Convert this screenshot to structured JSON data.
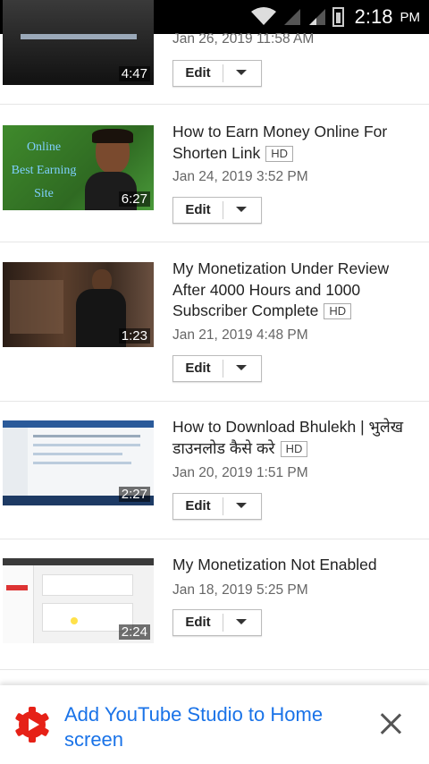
{
  "status_bar": {
    "time": "2:18",
    "ampm": "PM"
  },
  "videos": [
    {
      "duration": "4:47",
      "date": "Jan 26, 2019 11:58 AM",
      "edit_label": "Edit"
    },
    {
      "title": "How to Earn Money Online For Shorten Link",
      "hd": "HD",
      "duration": "6:27",
      "date": "Jan 24, 2019 3:52 PM",
      "edit_label": "Edit",
      "thumb_text": "Online\nBest Earning\nSite"
    },
    {
      "title": "My Monetization Under Review After 4000 Hours and 1000 Subscriber Complete",
      "hd": "HD",
      "duration": "1:23",
      "date": "Jan 21, 2019 4:48 PM",
      "edit_label": "Edit"
    },
    {
      "title": "How to Download Bhulekh | भुलेख डाउनलोड कैसे करे",
      "hd": "HD",
      "duration": "2:27",
      "date": "Jan 20, 2019 1:51 PM",
      "edit_label": "Edit"
    },
    {
      "title": "My Monetization Not Enabled",
      "duration": "2:24",
      "date": "Jan 18, 2019 5:25 PM",
      "edit_label": "Edit"
    }
  ],
  "banner": {
    "text": "Add YouTube Studio to Home screen"
  },
  "colors": {
    "banner_text": "#1a73e8",
    "studio_icon": "#e62117"
  }
}
